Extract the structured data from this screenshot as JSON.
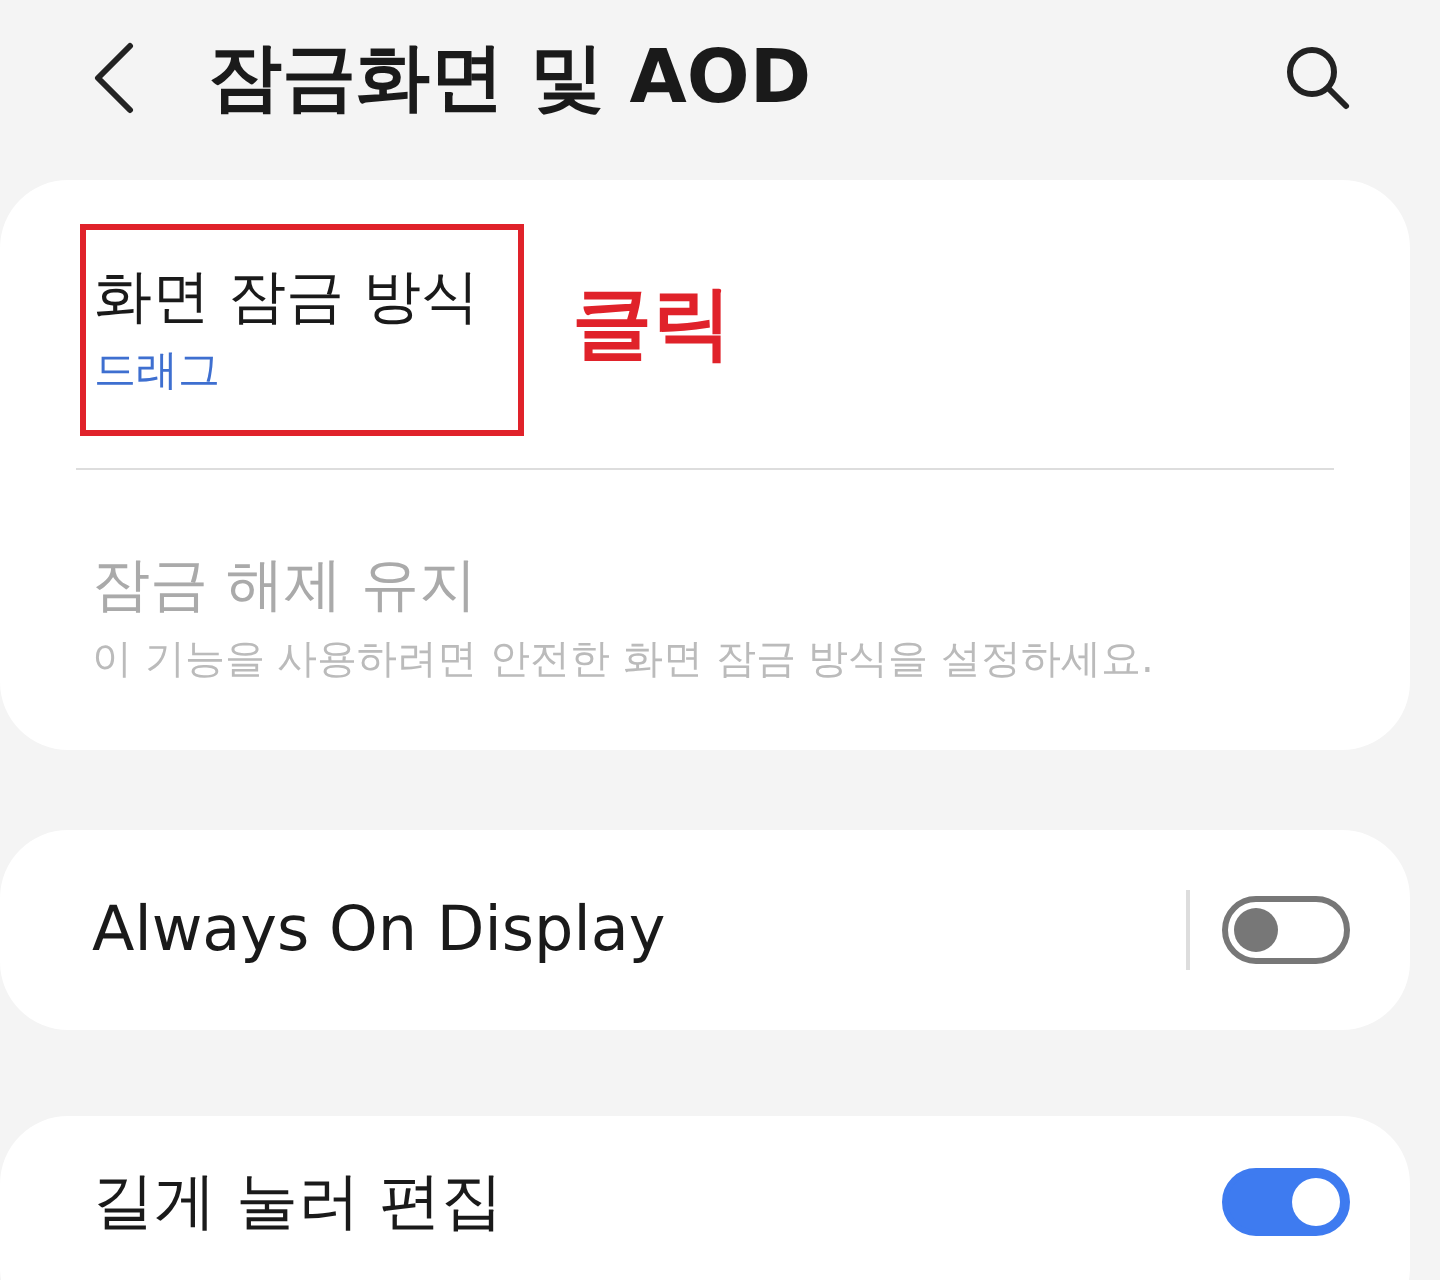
{
  "header": {
    "title": "잠금화면 및 AOD"
  },
  "groups": [
    {
      "items": [
        {
          "kind": "link",
          "title": "화면 잠금 방식",
          "summary": "드래그",
          "disabled": false,
          "highlighted": true,
          "note": "클릭"
        },
        {
          "kind": "link",
          "title": "잠금 해제 유지",
          "summary": "이 기능을 사용하려면 안전한 화면 잠금 방식을 설정하세요.",
          "disabled": true,
          "highlighted": false
        }
      ]
    },
    {
      "items": [
        {
          "kind": "switch",
          "title": "Always On Display",
          "on": false,
          "divider": true
        }
      ]
    },
    {
      "items": [
        {
          "kind": "switch",
          "title": "길게 눌러 편집",
          "on": true,
          "divider": false
        }
      ]
    }
  ]
}
